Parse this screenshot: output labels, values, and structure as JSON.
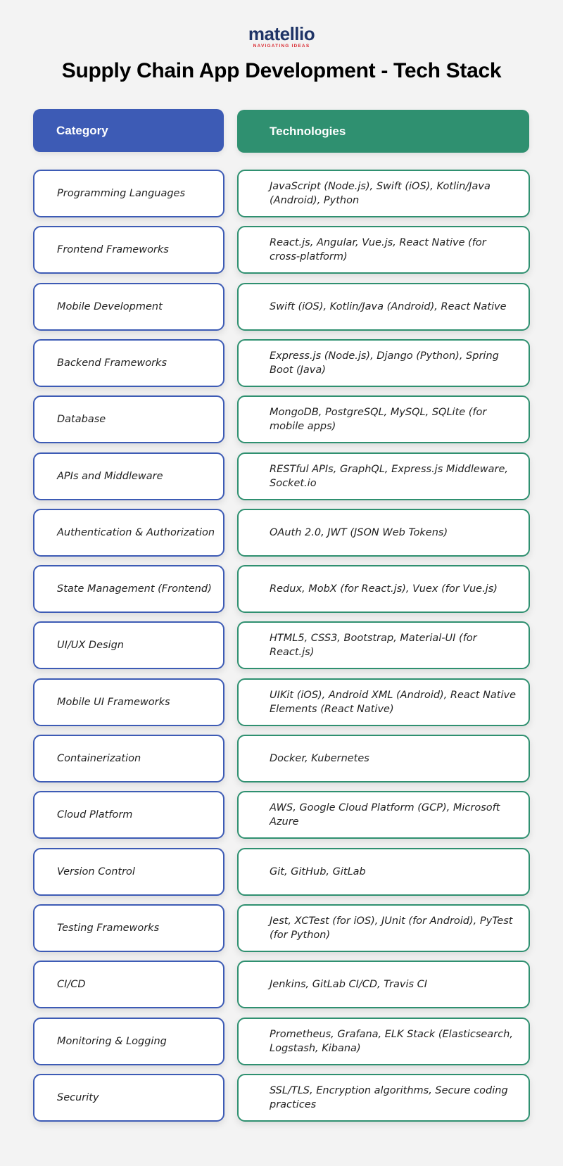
{
  "logo": {
    "wordmark": "matellio",
    "tagline": "NAVIGATING IDEAS"
  },
  "title": "Supply Chain App Development - Tech Stack",
  "colors": {
    "category_accent": "#3d5bb5",
    "technology_accent": "#2f9070",
    "logo_primary": "#1f3466",
    "logo_secondary": "#d9272e",
    "background": "#f3f3f3"
  },
  "table": {
    "headers": {
      "category": "Category",
      "technologies": "Technologies"
    },
    "rows": [
      {
        "category": "Programming Languages",
        "technologies": "JavaScript (Node.js), Swift (iOS), Kotlin/Java (Android), Python"
      },
      {
        "category": "Frontend Frameworks",
        "technologies": "React.js, Angular, Vue.js, React Native (for cross-platform)"
      },
      {
        "category": "Mobile Development",
        "technologies": "Swift (iOS), Kotlin/Java (Android), React Native"
      },
      {
        "category": "Backend Frameworks",
        "technologies": "Express.js (Node.js), Django (Python), Spring Boot (Java)"
      },
      {
        "category": "Database",
        "technologies": "MongoDB, PostgreSQL, MySQL, SQLite (for mobile apps)"
      },
      {
        "category": "APIs and Middleware",
        "technologies": "RESTful APIs, GraphQL, Express.js Middleware, Socket.io"
      },
      {
        "category": "Authentication & Authorization",
        "technologies": "OAuth 2.0, JWT (JSON Web Tokens)"
      },
      {
        "category": "State Management (Frontend)",
        "technologies": "Redux, MobX (for React.js), Vuex (for Vue.js)"
      },
      {
        "category": "UI/UX Design",
        "technologies": "HTML5, CSS3, Bootstrap, Material-UI (for React.js)"
      },
      {
        "category": "Mobile UI Frameworks",
        "technologies": "UIKit (iOS), Android XML (Android), React Native Elements (React Native)"
      },
      {
        "category": "Containerization",
        "technologies": "Docker, Kubernetes"
      },
      {
        "category": "Cloud Platform",
        "technologies": "AWS, Google Cloud Platform (GCP), Microsoft Azure"
      },
      {
        "category": "Version Control",
        "technologies": "Git, GitHub, GitLab"
      },
      {
        "category": "Testing Frameworks",
        "technologies": "Jest, XCTest (for iOS), JUnit (for Android), PyTest (for Python)"
      },
      {
        "category": "CI/CD",
        "technologies": "Jenkins, GitLab CI/CD, Travis CI"
      },
      {
        "category": "Monitoring & Logging",
        "technologies": "Prometheus, Grafana, ELK Stack (Elasticsearch, Logstash, Kibana)"
      },
      {
        "category": "Security",
        "technologies": "SSL/TLS, Encryption algorithms, Secure coding practices"
      }
    ]
  }
}
